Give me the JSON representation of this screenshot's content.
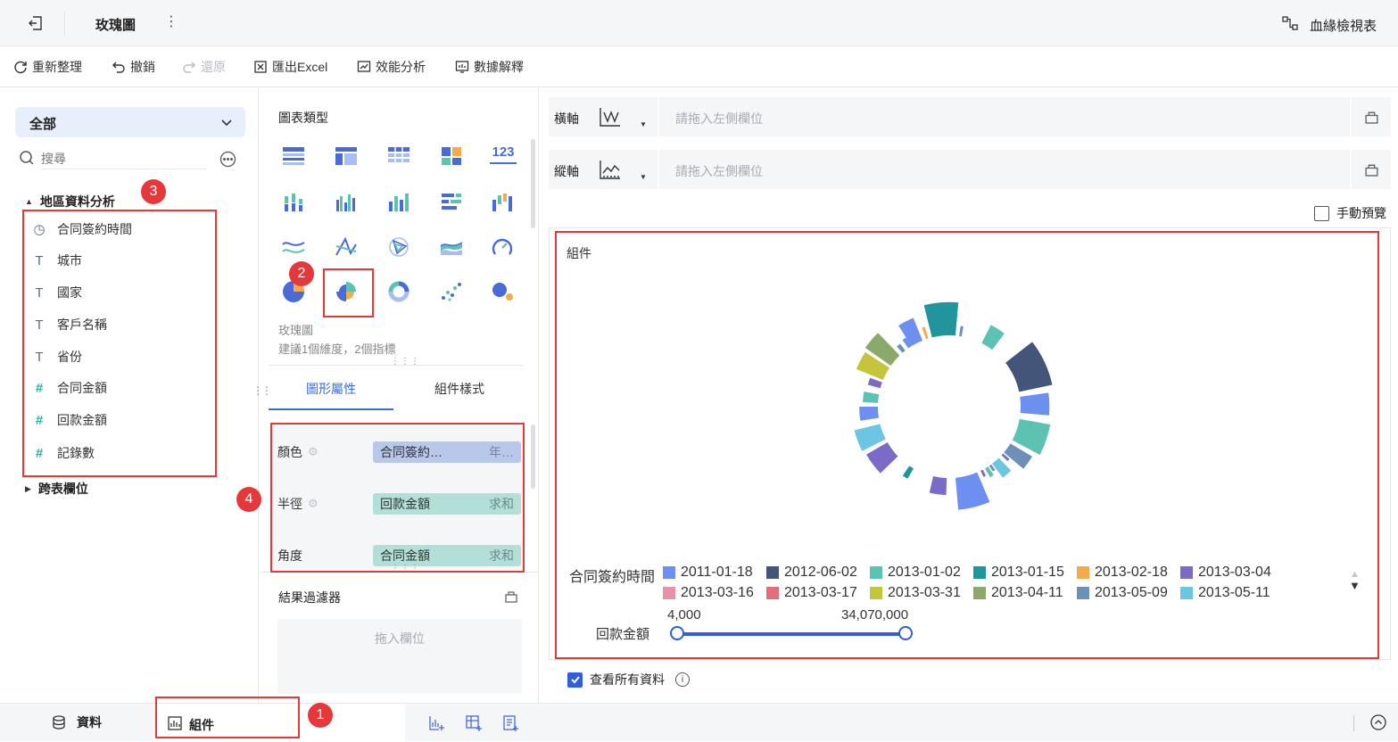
{
  "topbar": {
    "back_icon": "exit-icon",
    "title": "玫瑰圖",
    "more_icon": "vertical-dots-icon",
    "lineage_label": "血緣檢視表",
    "lineage_icon": "lineage-icon"
  },
  "toolbar": {
    "refresh": "重新整理",
    "undo": "撤銷",
    "redo": "還原",
    "export": "匯出Excel",
    "perf": "效能分析",
    "explain": "數據解釋"
  },
  "left": {
    "scope": "全部",
    "search_placeholder": "搜尋",
    "group": "地區資料分析",
    "fields": [
      {
        "label": "合同簽約時間",
        "icon": "clock-icon"
      },
      {
        "label": "城市",
        "icon": "text-type-icon"
      },
      {
        "label": "國家",
        "icon": "text-type-icon"
      },
      {
        "label": "客戶名稱",
        "icon": "text-type-icon"
      },
      {
        "label": "省份",
        "icon": "text-type-icon"
      },
      {
        "label": "合同金額",
        "icon": "number-type-icon"
      },
      {
        "label": "回款金額",
        "icon": "number-type-icon"
      },
      {
        "label": "記錄數",
        "icon": "record-count-icon"
      }
    ],
    "cross_table": "跨表欄位"
  },
  "mid": {
    "chart_type_title": "圖表類型",
    "selected_chart": "玫瑰圖",
    "hint": "建議1個維度，2個指標",
    "tabs": [
      "圖形屬性",
      "組件樣式"
    ],
    "props": [
      {
        "name": "顏色",
        "field": "合同簽約…",
        "agg": "年…",
        "color": "#b8c8ea"
      },
      {
        "name": "半徑",
        "field": "回款金額",
        "agg": "求和",
        "color": "#b2e0d8"
      },
      {
        "name": "角度",
        "field": "合同金額",
        "agg": "求和",
        "color": "#b2e0d8"
      }
    ],
    "filter_title": "結果過濾器",
    "filter_drop": "拖入欄位",
    "number_icon_text": "123"
  },
  "right": {
    "x_axis": "橫軸",
    "y_axis": "縱軸",
    "axis_placeholder": "請拖入左側欄位",
    "manual_preview": "手動預覽",
    "widget_title": "組件",
    "view_all": "查看所有資料",
    "legend_title": "合同簽約時間",
    "legend": [
      {
        "label": "2011-01-18",
        "color": "#6d8ff0"
      },
      {
        "label": "2012-06-02",
        "color": "#44557a"
      },
      {
        "label": "2013-01-02",
        "color": "#5cc2b1"
      },
      {
        "label": "2013-01-15",
        "color": "#20959b"
      },
      {
        "label": "2013-02-18",
        "color": "#f5ab4a"
      },
      {
        "label": "2013-03-04",
        "color": "#7b6bc6"
      },
      {
        "label": "2013-03-16",
        "color": "#e891a7"
      },
      {
        "label": "2013-03-17",
        "color": "#e46d7d"
      },
      {
        "label": "2013-03-31",
        "color": "#c4c53a"
      },
      {
        "label": "2013-04-11",
        "color": "#8aaa6c"
      },
      {
        "label": "2013-05-09",
        "color": "#6e8fb8"
      },
      {
        "label": "2013-05-11",
        "color": "#6cc6e2"
      }
    ],
    "range_label": "回款金額",
    "range_min": "4,000",
    "range_max": "34,070,000"
  },
  "bottom": {
    "data_tab": "資料",
    "widget_tab": "組件"
  },
  "badges": [
    "1",
    "2",
    "3",
    "4"
  ],
  "chart_data": {
    "type": "rose",
    "title": "",
    "series_field": "合同簽約時間",
    "radius_field": "回款金額",
    "angle_field": "合同金額",
    "categories": [
      "2011-01-18",
      "2012-06-02",
      "2013-01-02",
      "2013-01-15",
      "2013-02-18",
      "2013-03-04",
      "2013-03-16",
      "2013-03-17",
      "2013-03-31",
      "2013-04-11",
      "2013-05-09",
      "2013-05-11"
    ],
    "segments": [
      {
        "color": "#6d8ff0",
        "a0": -32,
        "a1": -22,
        "r": 0.72
      },
      {
        "color": "#f5ab4a",
        "a0": -19,
        "a1": -17,
        "r": 0.36
      },
      {
        "color": "#20959b",
        "a0": -14,
        "a1": 5,
        "r": 0.98
      },
      {
        "color": "#6e8fb8",
        "a0": 8,
        "a1": 10,
        "r": 0.3
      },
      {
        "color": "#5cc2b1",
        "a0": 27,
        "a1": 37,
        "r": 0.6
      },
      {
        "color": "#44557a",
        "a0": 52,
        "a1": 78,
        "r": 1.0
      },
      {
        "color": "#6d8ff0",
        "a0": 82,
        "a1": 95,
        "r": 0.85
      },
      {
        "color": "#5cc2b1",
        "a0": 100,
        "a1": 118,
        "r": 0.92
      },
      {
        "color": "#6e8fb8",
        "a0": 121,
        "a1": 130,
        "r": 0.75
      },
      {
        "color": "#7b6bc6",
        "a0": 131,
        "a1": 133,
        "r": 0.25
      },
      {
        "color": "#6cc6e2",
        "a0": 136,
        "a1": 143,
        "r": 0.52
      },
      {
        "color": "#6e8fb8",
        "a0": 144,
        "a1": 146,
        "r": 0.2
      },
      {
        "color": "#5cc2b1",
        "a0": 147,
        "a1": 150,
        "r": 0.3
      },
      {
        "color": "#7b6bc6",
        "a0": 152,
        "a1": 154,
        "r": 0.2
      },
      {
        "color": "#6d8ff0",
        "a0": 157,
        "a1": 175,
        "r": 0.95
      },
      {
        "color": "#7b6bc6",
        "a0": 182,
        "a1": 193,
        "r": 0.5
      },
      {
        "color": "#20959b",
        "a0": 210,
        "a1": 214,
        "r": 0.35
      },
      {
        "color": "#7b6bc6",
        "a0": 226,
        "a1": 240,
        "r": 0.72
      },
      {
        "color": "#6cc6e2",
        "a0": 243,
        "a1": 256,
        "r": 0.78
      },
      {
        "color": "#6d8ff0",
        "a0": 261,
        "a1": 270,
        "r": 0.55
      },
      {
        "color": "#5cc2b1",
        "a0": 273,
        "a1": 280,
        "r": 0.45
      },
      {
        "color": "#7b6bc6",
        "a0": 285,
        "a1": 290,
        "r": 0.38
      },
      {
        "color": "#c4c53a",
        "a0": 292,
        "a1": 303,
        "r": 0.85
      },
      {
        "color": "#8aaa6c",
        "a0": 305,
        "a1": 316,
        "r": 0.92
      },
      {
        "color": "#6e8fb8",
        "a0": 319,
        "a1": 322,
        "r": 0.25
      },
      {
        "color": "#6d8ff0",
        "a0": 325,
        "a1": 328,
        "r": 0.3
      }
    ]
  }
}
